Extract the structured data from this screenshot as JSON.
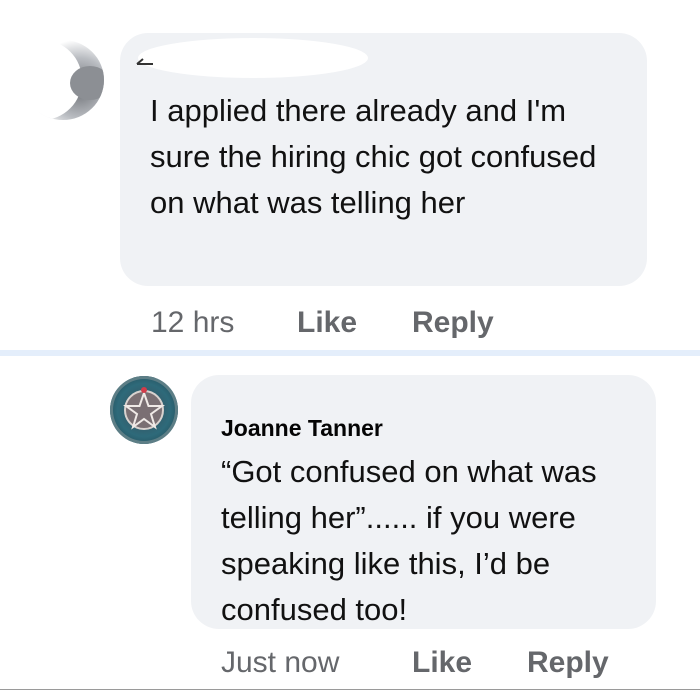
{
  "comments": [
    {
      "author": "",
      "text": "I applied there already and I'm sure the hiring chic got confused on what was telling her",
      "time": "12 hrs",
      "like_label": "Like",
      "reply_label": "Reply"
    },
    {
      "author": "Joanne Tanner",
      "text": "“Got confused on what was telling her”......  if you were speaking like this, I’d be confused too!",
      "time": "Just now",
      "like_label": "Like",
      "reply_label": "Reply"
    }
  ],
  "icons": {
    "avatar_1": "redacted-avatar",
    "avatar_2": "pentacle-avatar-icon"
  },
  "colors": {
    "bubble": "#f0f2f5",
    "meta_text": "#65676b",
    "divider": "#e4eefb"
  }
}
